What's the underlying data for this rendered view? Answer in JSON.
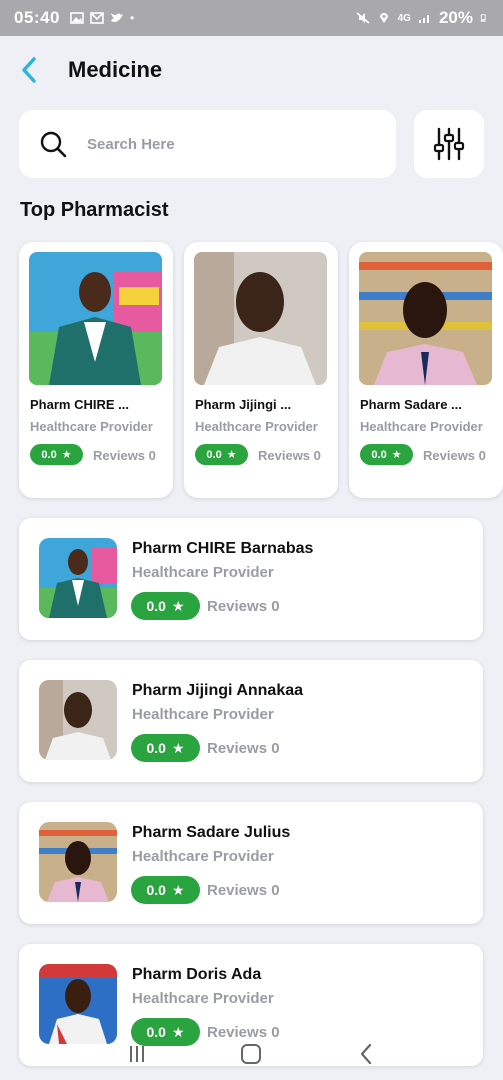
{
  "status_bar": {
    "time": "05:40",
    "battery": "20%",
    "network": "4G"
  },
  "header": {
    "title": "Medicine"
  },
  "search": {
    "placeholder": "Search Here"
  },
  "section": {
    "top_title": "Top Pharmacist"
  },
  "top_pharmacists": [
    {
      "name": "Pharm CHIRE ...",
      "role": "Healthcare Provider",
      "rating": "0.0",
      "reviews": "Reviews 0"
    },
    {
      "name": "Pharm Jijingi ...",
      "role": "Healthcare Provider",
      "rating": "0.0",
      "reviews": "Reviews 0"
    },
    {
      "name": "Pharm Sadare ...",
      "role": "Healthcare Provider",
      "rating": "0.0",
      "reviews": "Reviews 0"
    }
  ],
  "pharmacists": [
    {
      "name": "Pharm CHIRE Barnabas",
      "role": "Healthcare Provider",
      "rating": "0.0",
      "reviews": "Reviews 0"
    },
    {
      "name": "Pharm Jijingi Annakaa",
      "role": "Healthcare Provider",
      "rating": "0.0",
      "reviews": "Reviews 0"
    },
    {
      "name": "Pharm Sadare Julius",
      "role": "Healthcare Provider",
      "rating": "0.0",
      "reviews": "Reviews 0"
    },
    {
      "name": "Pharm Doris Ada",
      "role": "Healthcare Provider",
      "rating": "0.0",
      "reviews": "Reviews 0"
    }
  ],
  "colors": {
    "accent": "#29b6d8",
    "rating_green": "#2aa43f",
    "background": "#eef0f6",
    "muted_text": "#9a9ca3"
  },
  "icons": {
    "back": "chevron-left-icon",
    "search": "search-icon",
    "filter": "sliders-icon",
    "rating": "star-icon"
  }
}
